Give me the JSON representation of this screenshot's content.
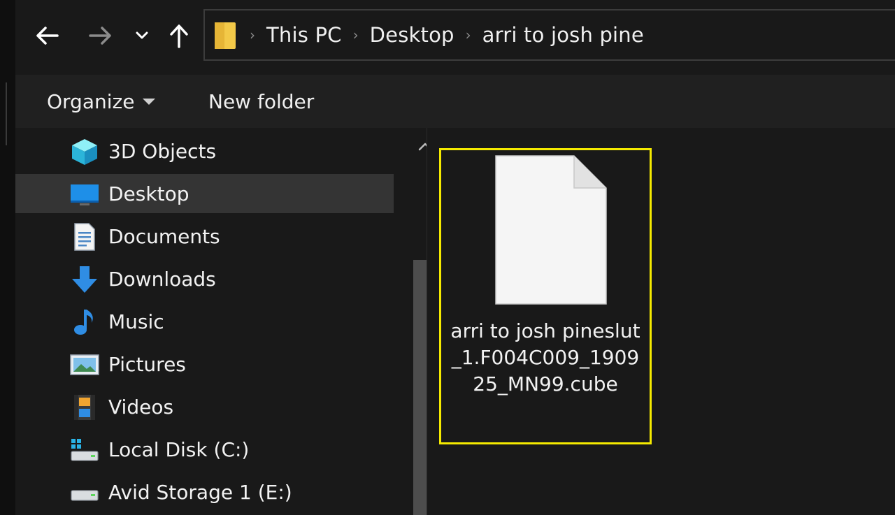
{
  "address_bar": {
    "breadcrumbs": [
      "This PC",
      "Desktop",
      "arri to josh pine"
    ]
  },
  "toolbar": {
    "organize_label": "Organize",
    "new_folder_label": "New folder"
  },
  "nav_pane": {
    "items": [
      {
        "label": "3D Objects",
        "icon": "3d-objects-icon",
        "selected": false
      },
      {
        "label": "Desktop",
        "icon": "desktop-icon",
        "selected": true
      },
      {
        "label": "Documents",
        "icon": "documents-icon",
        "selected": false
      },
      {
        "label": "Downloads",
        "icon": "downloads-icon",
        "selected": false
      },
      {
        "label": "Music",
        "icon": "music-icon",
        "selected": false
      },
      {
        "label": "Pictures",
        "icon": "pictures-icon",
        "selected": false
      },
      {
        "label": "Videos",
        "icon": "videos-icon",
        "selected": false
      },
      {
        "label": "Local Disk (C:)",
        "icon": "local-disk-icon",
        "selected": false
      },
      {
        "label": "Avid Storage 1 (E:)",
        "icon": "drive-icon",
        "selected": false
      }
    ]
  },
  "files": [
    {
      "name": "arri to josh pineslut_1.F004C009_190925_MN99.cube",
      "icon": "blank-file-icon",
      "highlighted": true
    }
  ],
  "colors": {
    "highlight_border": "#f5ea00",
    "selected_bg": "#343434",
    "window_bg": "#191919"
  }
}
